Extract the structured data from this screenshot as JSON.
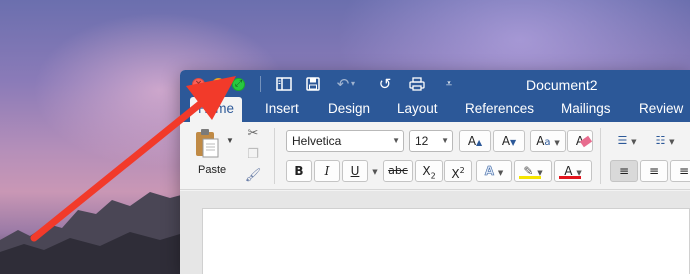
{
  "window": {
    "title": "Document2"
  },
  "quick_access": {
    "icons": [
      "sidebar-icon",
      "save-icon",
      "undo-icon",
      "redo-icon",
      "print-icon",
      "customize-icon"
    ]
  },
  "tabs": [
    {
      "label": "Home",
      "active": true
    },
    {
      "label": "Insert"
    },
    {
      "label": "Design"
    },
    {
      "label": "Layout"
    },
    {
      "label": "References"
    },
    {
      "label": "Mailings"
    },
    {
      "label": "Review"
    }
  ],
  "clipboard": {
    "paste_label": "Paste"
  },
  "font": {
    "family": "Helvetica",
    "size": "12"
  },
  "format_buttons": {
    "bold": "B",
    "italic": "I",
    "underline": "U",
    "strikethrough": "abc",
    "subscript": "X",
    "subscript_mark": "2",
    "superscript": "X",
    "superscript_mark": "2",
    "font_color_letter": "A",
    "clear_letter": "A"
  },
  "colors": {
    "title_bar": "#2c5898",
    "ribbon": "#f3f3f3",
    "arrow": "#f23a2a",
    "highlight": "#f5e400",
    "font_color": "#e2141c"
  }
}
